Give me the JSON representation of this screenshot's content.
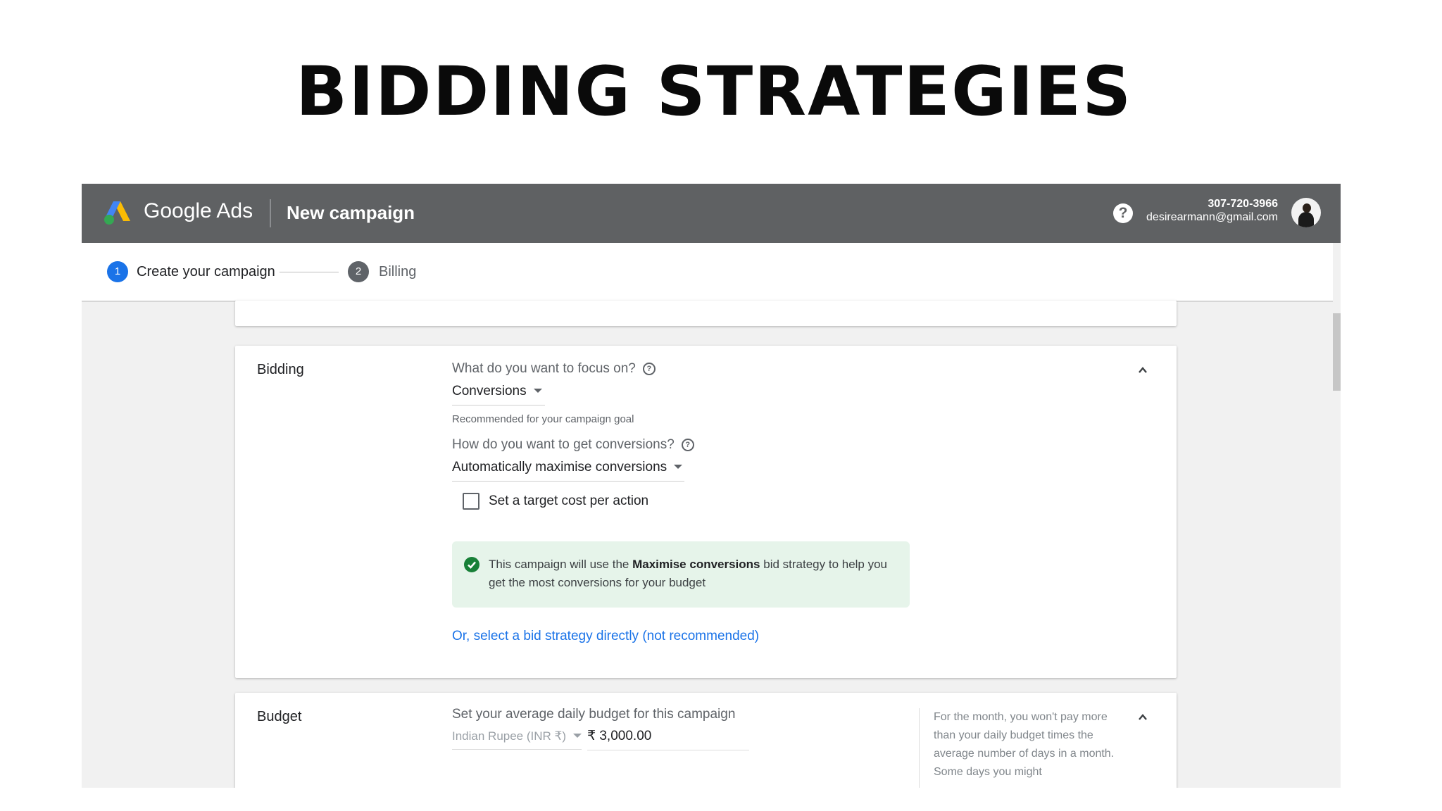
{
  "slide": {
    "title": "BIDDING STRATEGIES"
  },
  "header": {
    "brand": "Google Ads",
    "page_title": "New campaign",
    "account_id": "307-720-3966",
    "account_email": "desirearmann@gmail.com"
  },
  "stepper": {
    "steps": [
      {
        "number": "1",
        "label": "Create your campaign",
        "state": "active"
      },
      {
        "number": "2",
        "label": "Billing",
        "state": "pending"
      }
    ]
  },
  "bidding": {
    "section_label": "Bidding",
    "focus_question": "What do you want to focus on?",
    "focus_value": "Conversions",
    "focus_hint": "Recommended for your campaign goal",
    "conversions_question": "How do you want to get conversions?",
    "conversions_value": "Automatically maximise conversions",
    "target_cpa_label": "Set a target cost per action",
    "target_cpa_checked": false,
    "notice_prefix": "This campaign will use the ",
    "notice_bold": "Maximise conversions",
    "notice_suffix": " bid strategy to help you get the most conversions for your budget",
    "select_link": "Or, select a bid strategy directly (not recommended)"
  },
  "budget": {
    "section_label": "Budget",
    "question": "Set your average daily budget for this campaign",
    "currency": "Indian Rupee (INR ₹)",
    "amount": "₹ 3,000.00",
    "side_note": "For the month, you won't pay more than your daily budget times the average number of days in a month. Some days you might"
  },
  "colors": {
    "header_bg": "#5f6163",
    "accent": "#1a73e8",
    "success": "#188038",
    "notice_bg": "#e6f4ea"
  }
}
